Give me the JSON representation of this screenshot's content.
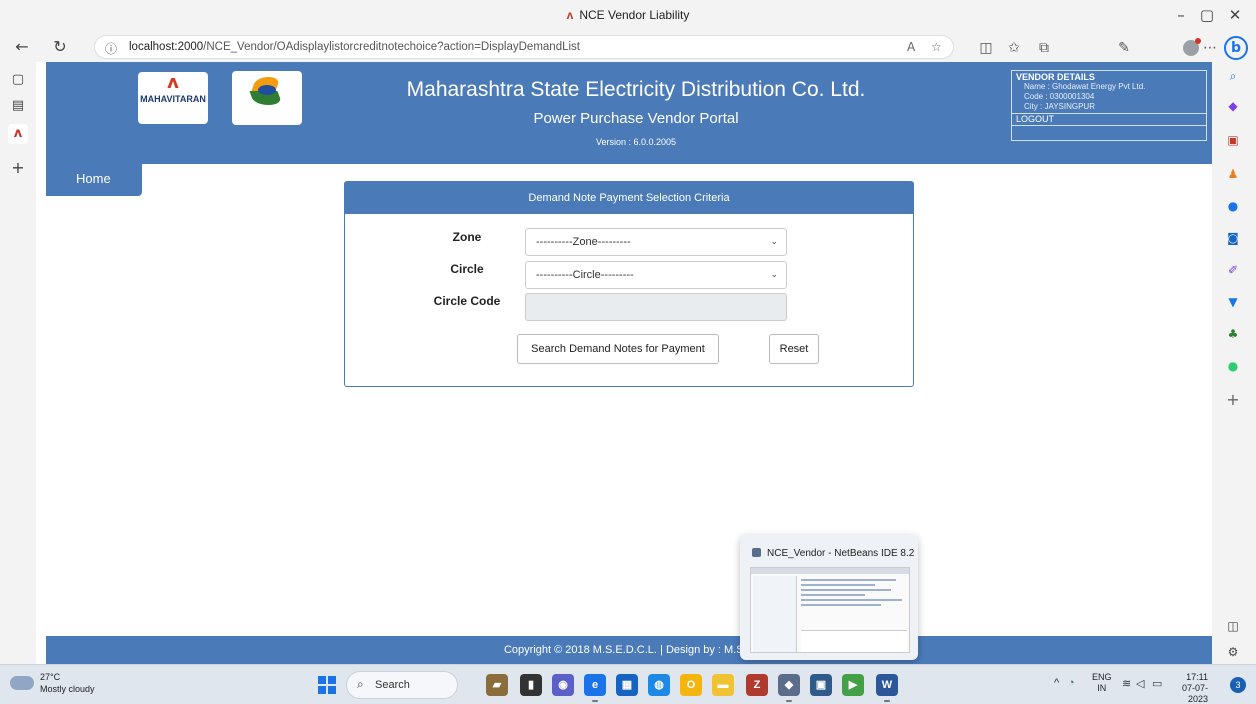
{
  "browser": {
    "window_title": "NCE Vendor Liability",
    "url_host": "localhost:2000",
    "url_path": "/NCE_Vendor/OAdisplaylistorcreditnotechoice?action=DisplayDemandList"
  },
  "header": {
    "logo_text": "MAHAVITARAN",
    "company": "Maharashtra State Electricity Distribution Co. Ltd.",
    "portal": "Power Purchase Vendor Portal",
    "version": "Version : 6.0.0.2005"
  },
  "vendor": {
    "heading": "VENDOR DETAILS",
    "name": "Name : Ghodawat Energy Pvt Ltd.",
    "code": "Code : 0300001304",
    "city": "City : JAYSINGPUR",
    "logout": "LOGOUT"
  },
  "nav": {
    "home": "Home"
  },
  "form": {
    "title": "Demand Note Payment Selection Criteria",
    "zone_label": "Zone",
    "zone_value": "----------Zone---------",
    "circle_label": "Circle",
    "circle_value": "----------Circle---------",
    "circle_code_label": "Circle Code",
    "search_button": "Search Demand Notes for Payment",
    "reset_button": "Reset"
  },
  "footer": {
    "text": "Copyright © 2018 M.S.E.D.C.L. | Design by : M.S.E"
  },
  "preview": {
    "title": "NCE_Vendor - NetBeans IDE 8.2"
  },
  "taskbar": {
    "temperature": "27°C",
    "condition": "Mostly cloudy",
    "search": "Search",
    "lang_top": "ENG",
    "lang_bottom": "IN",
    "time": "17:11",
    "date": "07-07-2023",
    "notifications": "3"
  },
  "colors": {
    "brand_blue": "#4a7ab8",
    "brand_red": "#d9381e"
  }
}
